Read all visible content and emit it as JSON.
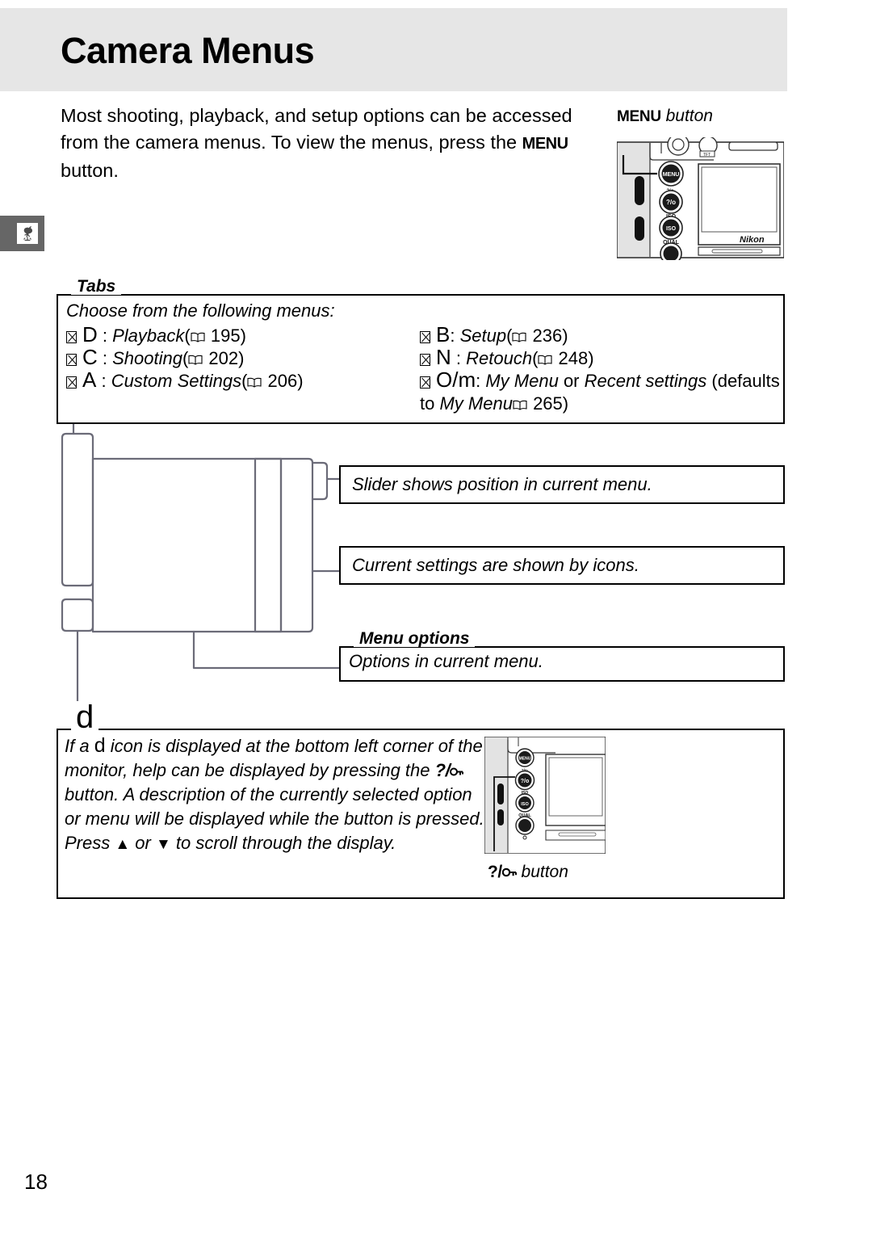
{
  "page": {
    "title": "Camera Menus",
    "number": "18"
  },
  "intro": {
    "part1": "Most shooting, playback, and setup options can be accessed from the camera menus.  To view the menus, press the ",
    "menu_key": "MENU",
    "part2": " button."
  },
  "menu_button_caption": {
    "key": "MENU",
    "word": "button"
  },
  "chapter_tab": {
    "icon": "rooster-weathervane-icon"
  },
  "tabs_section": {
    "title": "Tabs",
    "intro": "Choose from the following menus:",
    "left_items": [
      {
        "bullet": "missing-glyph",
        "letter": "D",
        "sep": " : ",
        "name": "Playback",
        "ref_open": "(",
        "book": "book-icon",
        "page": " 195",
        "ref_close": ")"
      },
      {
        "bullet": "missing-glyph",
        "letter": "C",
        "sep": " : ",
        "name": "Shooting",
        "ref_open": "(",
        "book": "book-icon",
        "page": " 202",
        "ref_close": ")"
      },
      {
        "bullet": "missing-glyph",
        "letter": "A",
        "sep": " : ",
        "name": "Custom Settings",
        "ref_open": "(",
        "book": "book-icon",
        "page": " 206",
        "ref_close": ")"
      }
    ],
    "right_items": [
      {
        "bullet": "missing-glyph",
        "letter": "B",
        "sep": ": ",
        "name": "Setup",
        "ref_open": "(",
        "book": "book-icon",
        "page": " 236",
        "ref_close": ")"
      },
      {
        "bullet": "missing-glyph",
        "letter": "N",
        "sep": " : ",
        "name": "Retouch",
        "ref_open": "(",
        "book": "book-icon",
        "page": " 248",
        "ref_close": ")"
      }
    ],
    "mymenu_item": {
      "bullet": "missing-glyph",
      "letter": "O/m",
      "sep": ": ",
      "name1": "My Menu",
      "mid": " or ",
      "name2": "Recent settings",
      "tail": " (defaults to ",
      "name3": "My Menu",
      "book": "book-icon",
      "page": " 265",
      "ref_close": ")"
    }
  },
  "callouts": {
    "slider": "Slider shows position in current menu.",
    "settings": "Current settings are shown by icons."
  },
  "menu_options_section": {
    "title": "Menu options",
    "text": "Options in current menu."
  },
  "help_section": {
    "title_glyph": "d",
    "body_1": "If a ",
    "body_glyph": "d",
    "body_2": " icon is displayed at the bottom left corner of the monitor, help can be displayed by pressing the ",
    "qm_key": "?/",
    "qm_lock": "on",
    "body_3": " button.  A description of the currently selected option or menu will be displayed while the button is pressed.  Press ",
    "up_arrow": "▲",
    "or_word": " or ",
    "down_arrow": "▼",
    "body_4": " to scroll through the display."
  },
  "qm_button_caption": {
    "key": "?/",
    "lock": "on",
    "word": "button"
  },
  "camera_illustration": {
    "top": {
      "brand": "Nikon",
      "buttons": [
        "MENU",
        "?/on",
        "ISO",
        "QUAL"
      ]
    },
    "bottom": {
      "buttons": [
        "MENU",
        "?/on",
        "ISO",
        "QUAL"
      ]
    }
  },
  "colors": {
    "title_bar": "#e6e6e6",
    "chapter_tab": "#666666",
    "line_art": "#6b6b78",
    "border": "#000000"
  }
}
